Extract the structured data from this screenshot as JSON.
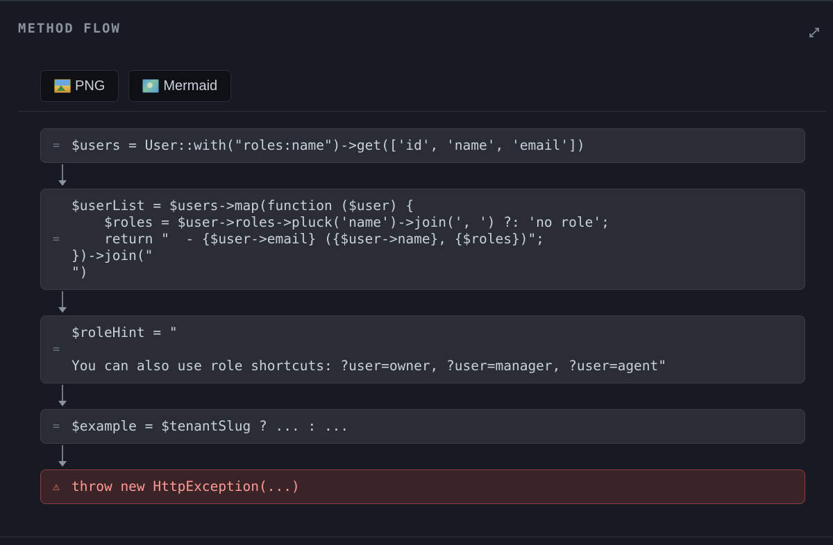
{
  "panel": {
    "title": "METHOD FLOW",
    "expand_icon": "expand-arrows-icon"
  },
  "export": {
    "png_label": "PNG",
    "png_icon": "image-icon",
    "mermaid_label": "Mermaid",
    "mermaid_icon": "map-icon"
  },
  "flow": {
    "nodes": [
      {
        "kind": "assignment",
        "marker": "=",
        "code": "$users = User::with(\"roles:name\")->get(['id', 'name', 'email'])"
      },
      {
        "kind": "assignment",
        "marker": "=",
        "code": "$userList = $users->map(function ($user) {\n    $roles = $user->roles->pluck('name')->join(', ') ?: 'no role';\n    return \"  - {$user->email} ({$user->name}, {$roles})\";\n})->join(\"\n\")"
      },
      {
        "kind": "assignment",
        "marker": "=",
        "code": "$roleHint = \"\n\nYou can also use role shortcuts: ?user=owner, ?user=manager, ?user=agent\""
      },
      {
        "kind": "assignment",
        "marker": "=",
        "code": "$example = $tenantSlug ? ... : ..."
      },
      {
        "kind": "throw",
        "marker": "⚠",
        "code": "throw new HttpException(...)"
      }
    ]
  },
  "colors": {
    "background": "#171a22",
    "node_bg": "#2a2d34",
    "node_border": "#3a3e47",
    "throw_bg": "#3a2428",
    "throw_border": "#8a3d42",
    "throw_text": "#ff9b94"
  }
}
